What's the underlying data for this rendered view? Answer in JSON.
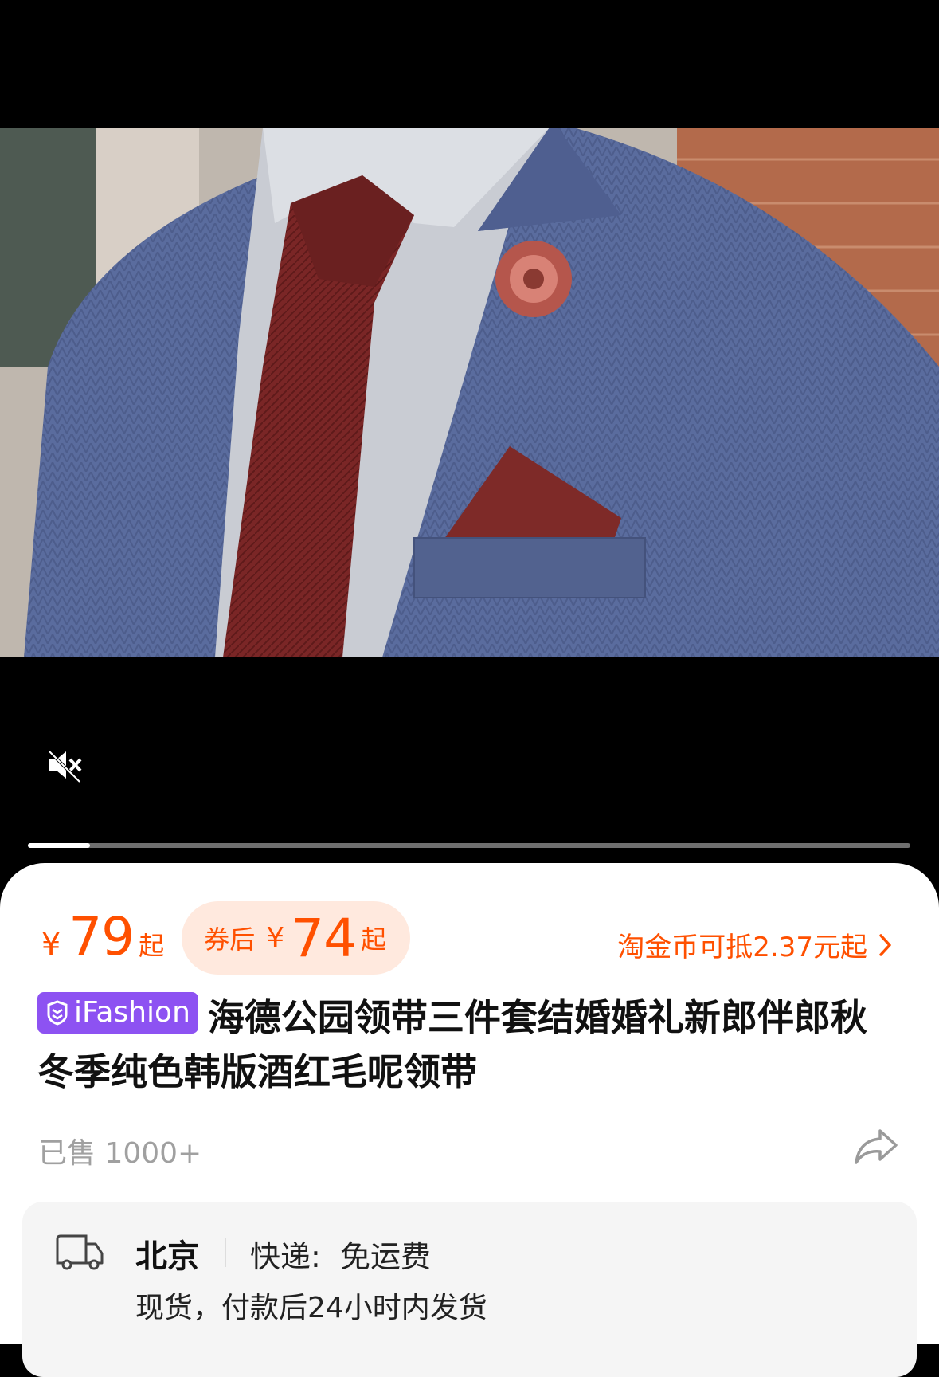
{
  "video": {
    "progress": 0.07,
    "mute_icon": "volume-muted-icon"
  },
  "price": {
    "currency": "¥",
    "amount": "79",
    "suffix": "起"
  },
  "coupon": {
    "label": "券后",
    "currency": "¥",
    "amount": "74",
    "suffix": "起"
  },
  "coins": {
    "text": "淘金币可抵2.37元起",
    "icon": "chevron-right-icon"
  },
  "title": {
    "badge": "iFashion",
    "text": "海德公园领带三件套结婚婚礼新郎伴郎秋冬季纯色韩版酒红毛呢领带"
  },
  "sold": "已售 1000+",
  "share_icon": "share-icon",
  "shipping": {
    "icon": "truck-icon",
    "city": "北京",
    "delivery": "快递:  免运费",
    "stock": "现货，付款后24小时内发货"
  },
  "colors": {
    "accent": "#ff5000",
    "coupon_bg": "#ffe9de",
    "badge": "#8d52f2"
  }
}
